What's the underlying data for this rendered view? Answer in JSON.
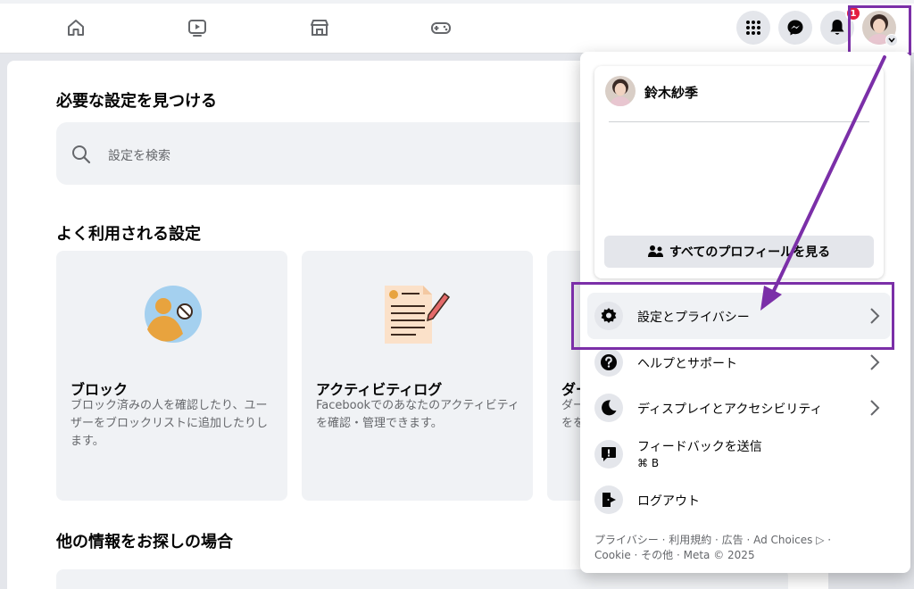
{
  "colors": {
    "accent": "#7b2fa8",
    "badge": "#e41e3f",
    "panel_bg": "#f0f2f5"
  },
  "topnav": {
    "icons": [
      "home-icon",
      "watch-icon",
      "marketplace-icon",
      "gaming-icon"
    ],
    "right_icons": [
      "menu-grid-icon",
      "messenger-icon",
      "notifications-icon"
    ],
    "badge": "1"
  },
  "settings": {
    "find_title": "必要な設定を見つける",
    "search_placeholder": "設定を検索",
    "frequent_title": "よく利用される設定",
    "cards": [
      {
        "title": "ブロック",
        "desc": "ブロック済みの人を確認したり、ユーザーをブロックリストに追加したりします。"
      },
      {
        "title": "アクティビティログ",
        "desc": "Facebookでのあなたのアクティビティを確認・管理できます。"
      },
      {
        "title": "ダー",
        "desc": "ダー\nをを"
      }
    ],
    "other_title": "他の情報をお探しの場合"
  },
  "dropdown": {
    "profile_name": "鈴木紗季",
    "see_all_profiles": "すべてのプロフィールを見る",
    "menu": [
      {
        "label": "設定とプライバシー",
        "icon": "gear-icon"
      },
      {
        "label": "ヘルプとサポート",
        "icon": "help-icon"
      },
      {
        "label": "ディスプレイとアクセシビリティ",
        "icon": "moon-icon"
      },
      {
        "label": "フィードバックを送信",
        "sub": "⌘ B",
        "icon": "feedback-icon"
      },
      {
        "label": "ログアウト",
        "icon": "logout-icon"
      }
    ],
    "footer_line1": "プライバシー · 利用規約 · 広告 · Ad Choices ▷ ·",
    "footer_line2": "Cookie · その他 · Meta © 2025"
  }
}
